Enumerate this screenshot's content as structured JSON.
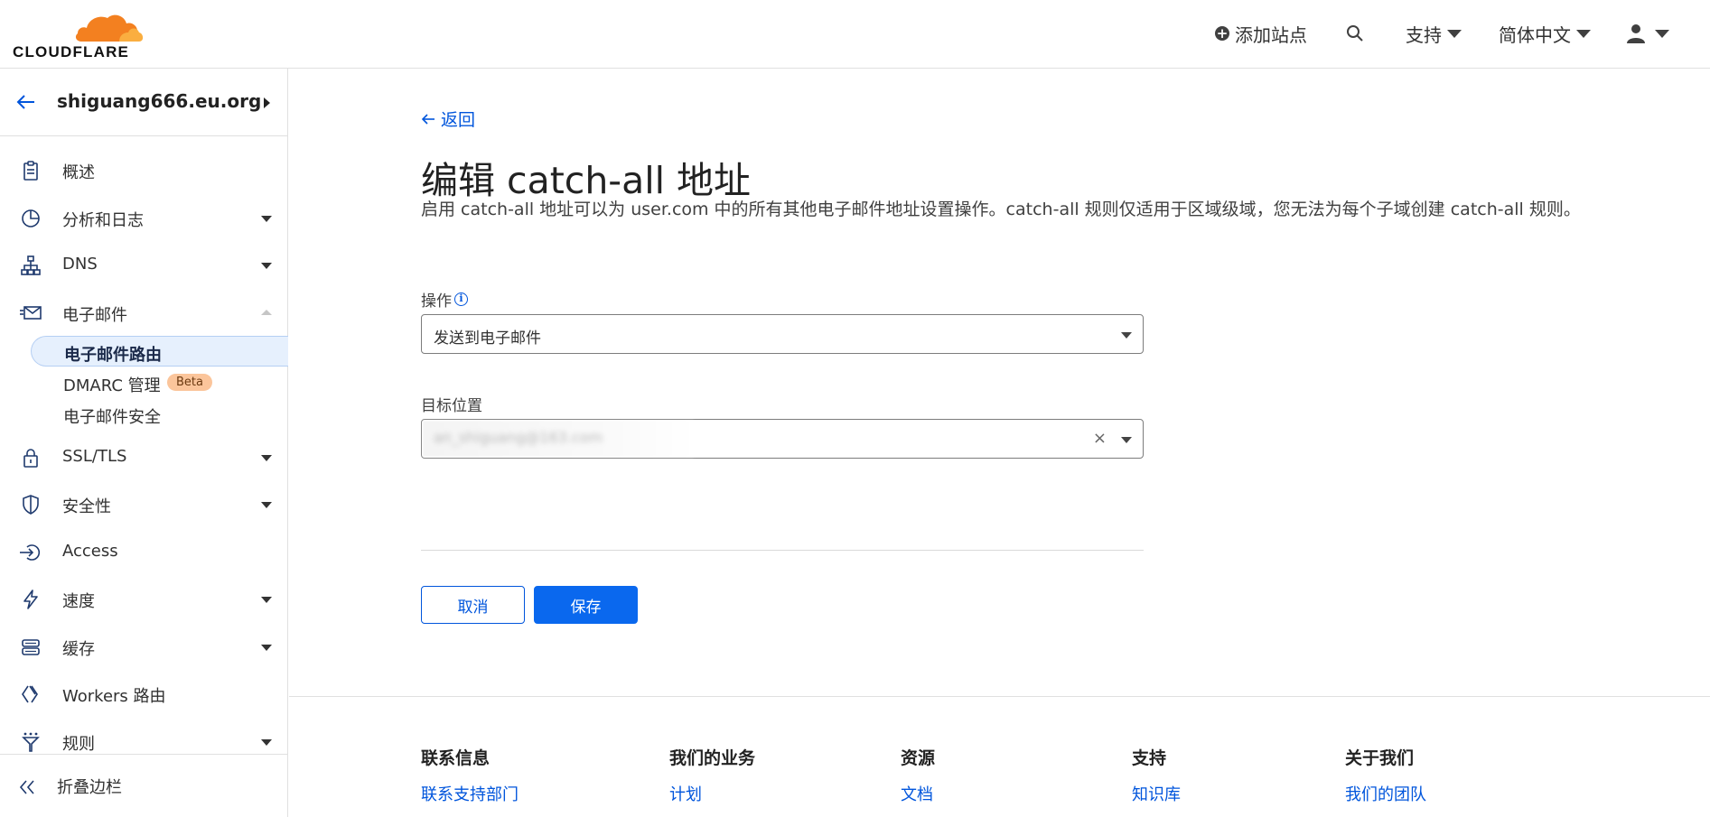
{
  "brand": {
    "name": "CLOUDFLARE",
    "orange": "#f38020",
    "orange_light": "#faae40"
  },
  "header": {
    "add_site": "添加站点",
    "support": "支持",
    "language": "简体中文"
  },
  "sidebar": {
    "zone": "shiguang666.eu.org",
    "items": [
      {
        "label": "概述",
        "icon": "clipboard-icon"
      },
      {
        "label": "分析和日志",
        "icon": "pie-chart-icon"
      },
      {
        "label": "DNS",
        "icon": "network-icon"
      },
      {
        "label": "电子邮件",
        "icon": "envelope-icon"
      },
      {
        "label": "SSL/TLS",
        "icon": "lock-icon"
      },
      {
        "label": "安全性",
        "icon": "shield-icon"
      },
      {
        "label": "Access",
        "icon": "access-icon"
      },
      {
        "label": "速度",
        "icon": "lightning-icon"
      },
      {
        "label": "缓存",
        "icon": "server-stack-icon"
      },
      {
        "label": "Workers 路由",
        "icon": "workers-icon"
      },
      {
        "label": "规则",
        "icon": "rules-icon"
      }
    ],
    "email_sub": [
      {
        "label": "电子邮件路由"
      },
      {
        "label": "DMARC 管理",
        "badge": "Beta"
      },
      {
        "label": "电子邮件安全"
      }
    ],
    "collapse": "折叠边栏"
  },
  "main": {
    "back": "返回",
    "title": "编辑 catch-all 地址",
    "description": "启用 catch-all 地址可以为 user.com 中的所有其他电子邮件地址设置操作。catch-all 规则仅适用于区域级域，您无法为每个子域创建 catch-all 规则。",
    "action_label": "操作",
    "action_value": "发送到电子邮件",
    "destination_label": "目标位置",
    "destination_value": "an_shiguang@163.com",
    "cancel": "取消",
    "save": "保存"
  },
  "footer": {
    "columns": [
      {
        "heading": "联系信息",
        "link": "联系支持部门"
      },
      {
        "heading": "我们的业务",
        "link": "计划"
      },
      {
        "heading": "资源",
        "link": "文档"
      },
      {
        "heading": "支持",
        "link": "知识库"
      },
      {
        "heading": "关于我们",
        "link": "我们的团队"
      }
    ]
  }
}
